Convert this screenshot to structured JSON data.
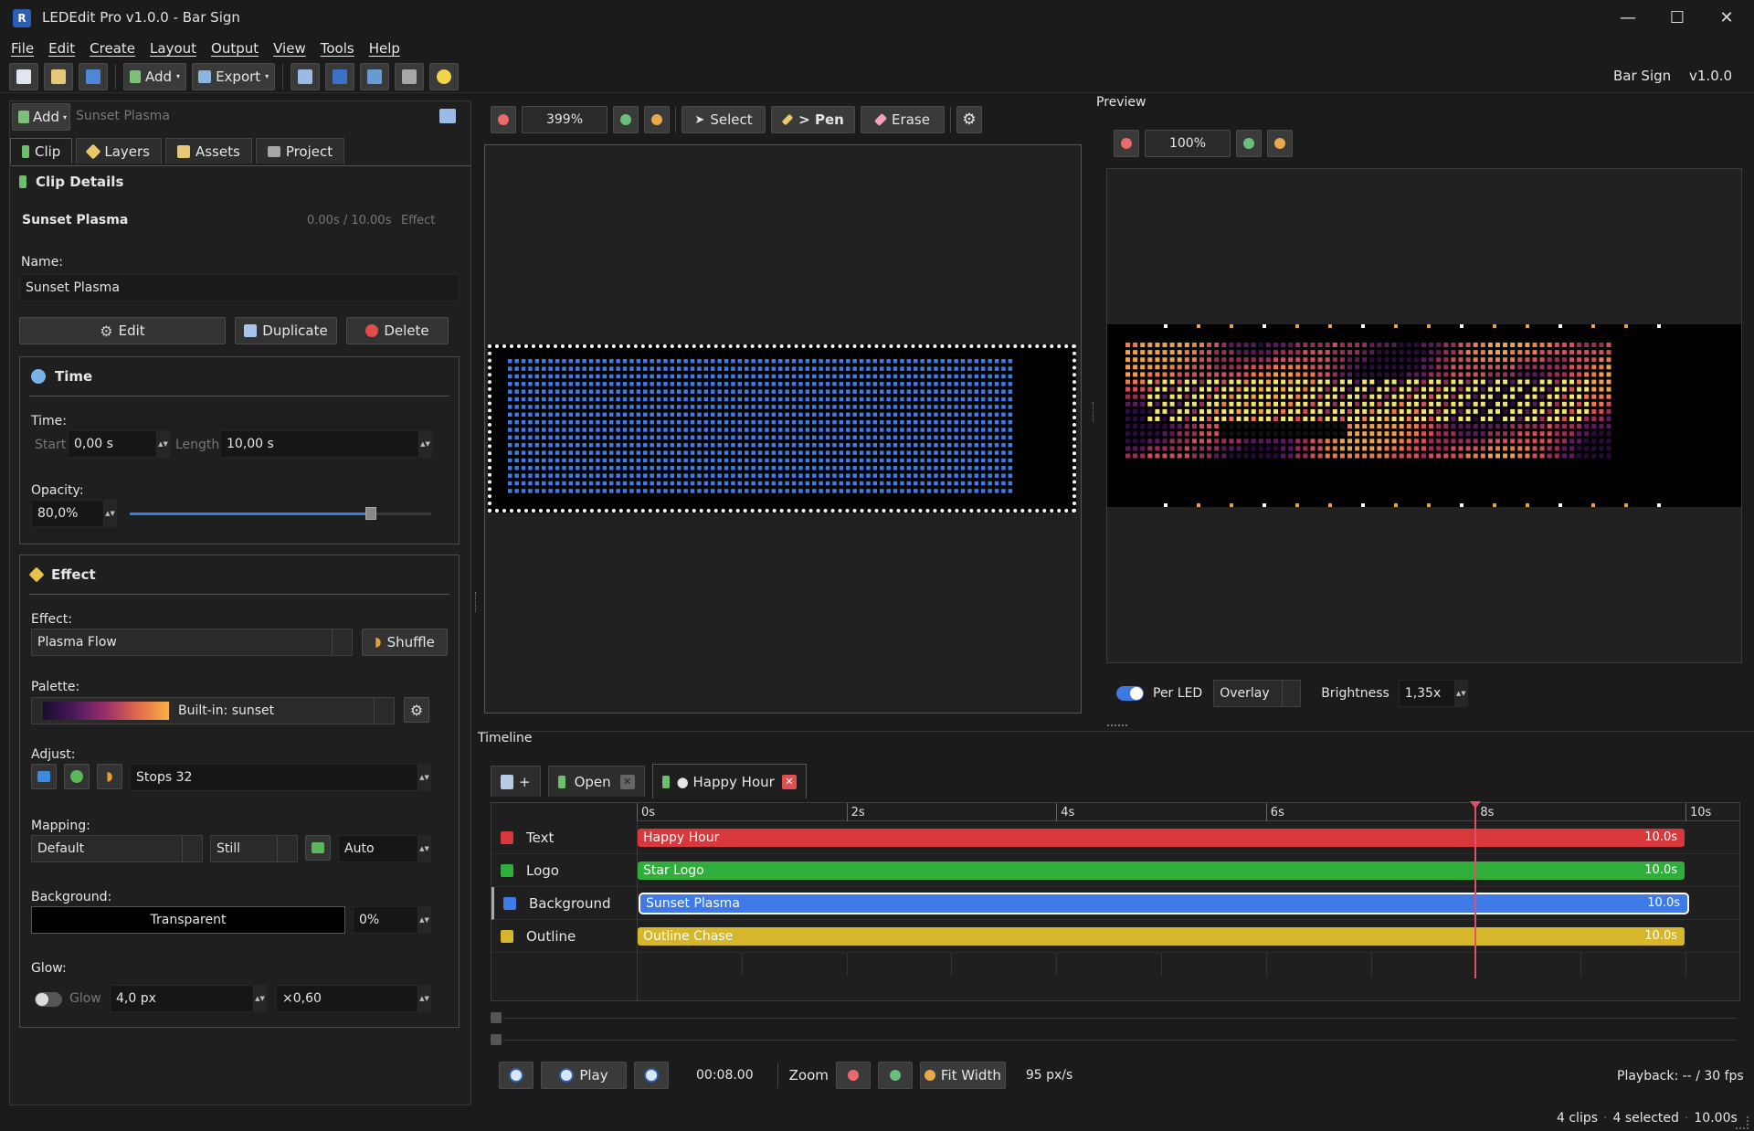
{
  "window": {
    "title": "LEDEdit Pro v1.0.0 - Bar Sign",
    "minimize": "—",
    "maximize": "☐",
    "close": "✕"
  },
  "menu": [
    "File",
    "Edit",
    "Create",
    "Layout",
    "Output",
    "View",
    "Tools",
    "Help"
  ],
  "toolbar": {
    "add_label": "Add",
    "export_label": "Export",
    "project_name": "Bar Sign",
    "version": "v1.0.0"
  },
  "left_panel": {
    "add_label": "Add",
    "current_clip": "Sunset Plasma",
    "tabs": [
      "Clip",
      "Layers",
      "Assets",
      "Project"
    ],
    "clip_details": {
      "heading": "Clip Details",
      "clip_name": "Sunset Plasma",
      "time_range": "0.00s / 10.00s",
      "clip_type": "Effect",
      "name_label": "Name:",
      "name_value": "Sunset Plasma",
      "edit_label": "Edit",
      "duplicate_label": "Duplicate",
      "delete_label": "Delete"
    },
    "time": {
      "heading": "Time",
      "time_label": "Time:",
      "start_label": "Start",
      "start_value": "0,00 s",
      "length_label": "Length",
      "length_value": "10,00 s",
      "opacity_label": "Opacity:",
      "opacity_value": "80,0%",
      "opacity_fraction": 0.8
    },
    "effect": {
      "heading": "Effect",
      "effect_label": "Effect:",
      "effect_value": "Plasma Flow",
      "shuffle_label": "Shuffle",
      "palette_label": "Palette:",
      "palette_value": "Built-in: sunset",
      "adjust_label": "Adjust:",
      "stops_value": "Stops 32",
      "mapping_label": "Mapping:",
      "mapping_value": "Default",
      "mode_value": "Still",
      "auto_value": "Auto",
      "background_label": "Background:",
      "background_value": "Transparent",
      "background_opacity": "0%",
      "glow_label": "Glow:",
      "glow_toggle_label": "Glow",
      "glow_radius": "4,0 px",
      "glow_factor": "×0,60"
    }
  },
  "canvas_toolbar": {
    "zoom": "399%",
    "select_label": "Select",
    "pen_label": "> Pen",
    "erase_label": "Erase"
  },
  "preview": {
    "title": "Preview",
    "zoom": "100%",
    "per_led_label": "Per LED",
    "blend_value": "Overlay",
    "brightness_label": "Brightness",
    "brightness_value": "1,35x"
  },
  "timeline": {
    "title": "Timeline",
    "new_tab_label": "+",
    "tabs": [
      {
        "label": "Open"
      },
      {
        "label": "● Happy Hour"
      }
    ],
    "ticks": [
      "0s",
      "2s",
      "4s",
      "6s",
      "8s",
      "10s"
    ],
    "playhead_seconds": 8,
    "duration_seconds": 10,
    "tracks": [
      {
        "name": "Text",
        "clip": "Happy Hour",
        "duration": "10.0s",
        "color": "#d8383c"
      },
      {
        "name": "Logo",
        "clip": "Star Logo",
        "duration": "10.0s",
        "color": "#2fae3c"
      },
      {
        "name": "Background",
        "clip": "Sunset Plasma",
        "duration": "10.0s",
        "color": "#3f7ae6"
      },
      {
        "name": "Outline",
        "clip": "Outline Chase",
        "duration": "10.0s",
        "color": "#d6b62a"
      }
    ],
    "play_label": "Play",
    "time_display": "00:08.00",
    "zoom_label": "Zoom",
    "fit_width_label": "Fit Width",
    "px_per_s": "95 px/s",
    "playback": "Playback: -- / 30 fps"
  },
  "statusbar": {
    "clips": "4 clips",
    "selected": "4 selected",
    "duration": "10.00s"
  }
}
